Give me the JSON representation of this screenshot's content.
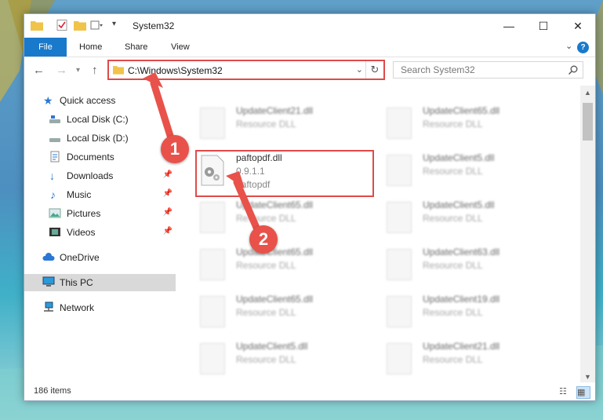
{
  "window": {
    "title": "System32",
    "controls": {
      "minimize": "—",
      "maximize": "☐",
      "close": "✕"
    }
  },
  "ribbon": {
    "tabs": [
      "File",
      "Home",
      "Share",
      "View"
    ],
    "help": "?"
  },
  "navigation": {
    "address": "C:\\Windows\\System32",
    "search_placeholder": "Search System32"
  },
  "sidebar": {
    "items": [
      {
        "label": "Quick access",
        "icon": "star-icon"
      },
      {
        "label": "Local Disk (C:)",
        "icon": "drive-icon"
      },
      {
        "label": "Local Disk (D:)",
        "icon": "drive-icon"
      },
      {
        "label": "Documents",
        "icon": "documents-icon"
      },
      {
        "label": "Downloads",
        "icon": "download-arrow-icon",
        "pinned": true
      },
      {
        "label": "Music",
        "icon": "music-note-icon",
        "pinned": true
      },
      {
        "label": "Pictures",
        "icon": "pictures-icon",
        "pinned": true
      },
      {
        "label": "Videos",
        "icon": "videos-icon",
        "pinned": true
      },
      {
        "label": "OneDrive",
        "icon": "cloud-icon"
      },
      {
        "label": "This PC",
        "icon": "computer-icon",
        "selected": true
      },
      {
        "label": "Network",
        "icon": "network-icon"
      }
    ]
  },
  "files": [
    {
      "name": "UpdateClient21.dll",
      "type": "Resource DLL",
      "blurred": true
    },
    {
      "name": "UpdateClient65.dll",
      "type": "Resource DLL",
      "blurred": true
    },
    {
      "name": "paftopdf.dll",
      "version": "0.9.1.1",
      "type": "paftopdf",
      "highlighted": true
    },
    {
      "name": "UpdateClient5.dll",
      "type": "Resource DLL",
      "blurred": true
    },
    {
      "name": "UpdateClient65.dll",
      "type": "Resource DLL",
      "blurred": true
    },
    {
      "name": "UpdateClient5.dll",
      "type": "Resource DLL",
      "blurred": true
    },
    {
      "name": "UpdateClient65.dll",
      "type": "Resource DLL",
      "blurred": true
    },
    {
      "name": "UpdateClient63.dll",
      "type": "Resource DLL",
      "blurred": true
    },
    {
      "name": "UpdateClient65.dll",
      "type": "Resource DLL",
      "blurred": true
    },
    {
      "name": "UpdateClient19.dll",
      "type": "Resource DLL",
      "blurred": true
    },
    {
      "name": "UpdateClient5.dll",
      "type": "Resource DLL",
      "blurred": true
    },
    {
      "name": "UpdateClient21.dll",
      "type": "Resource DLL",
      "blurred": true
    }
  ],
  "status": {
    "item_count": "186 items"
  },
  "callouts": [
    "1",
    "2"
  ],
  "colors": {
    "accent": "#1979ca",
    "highlight": "#e04a4a",
    "callout": "#e8524a"
  }
}
